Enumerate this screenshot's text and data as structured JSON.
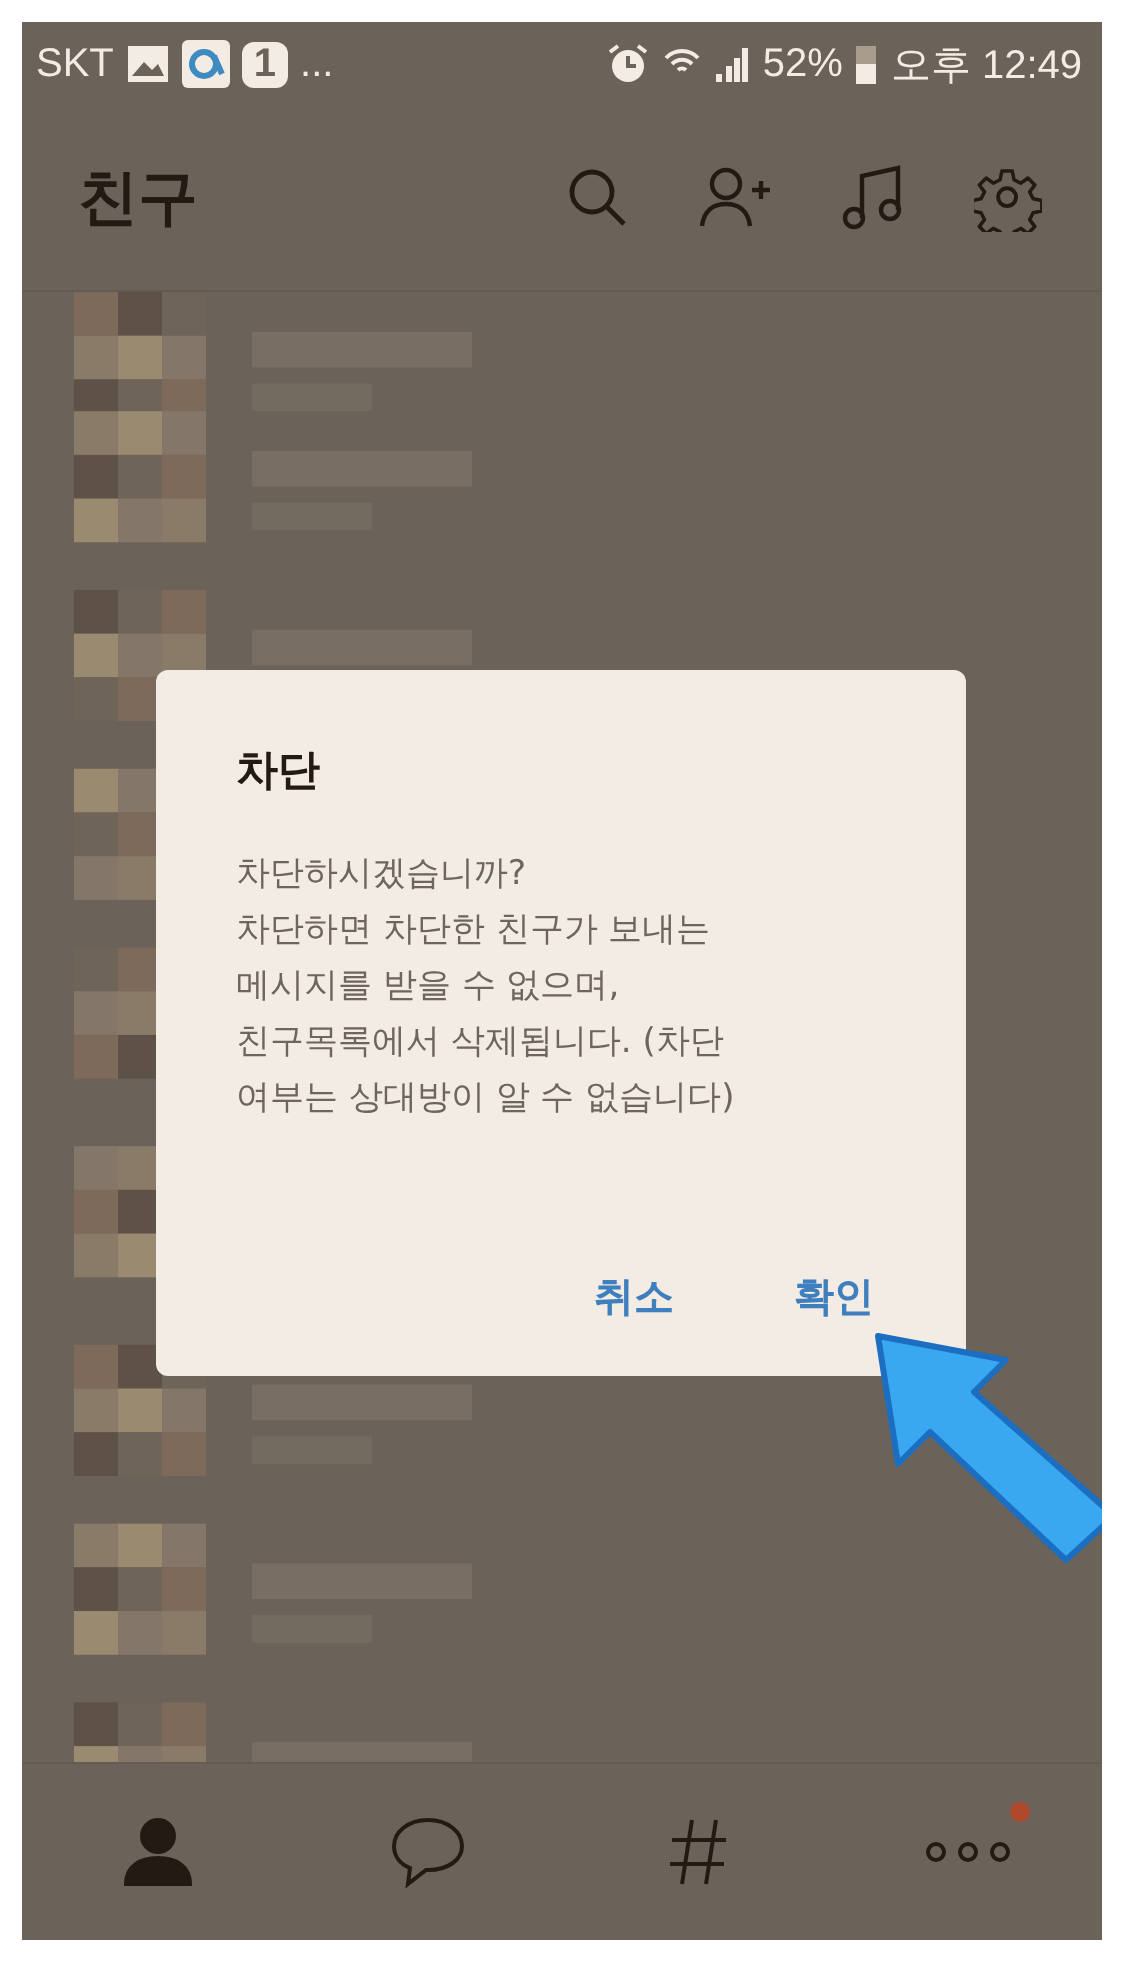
{
  "status_bar": {
    "carrier": "SKT",
    "notification_count": "1",
    "more": "...",
    "battery": "52%",
    "time": "오후 12:49"
  },
  "header": {
    "title": "친구"
  },
  "dialog": {
    "title": "차단",
    "message": "차단하시겠습니까?\n차단하면 차단한 친구가 보내는\n메시지를 받을 수 없으며,\n친구목록에서 삭제됩니다. (차단\n여부는 상대방이 알 수 없습니다)",
    "buttons": [
      "취소",
      "확인"
    ]
  },
  "bottom_nav": [
    {
      "kind": "friends",
      "selected": true
    },
    {
      "kind": "chats",
      "selected": false
    },
    {
      "kind": "hashtag",
      "selected": false
    },
    {
      "kind": "more",
      "selected": false,
      "badge": true
    }
  ]
}
